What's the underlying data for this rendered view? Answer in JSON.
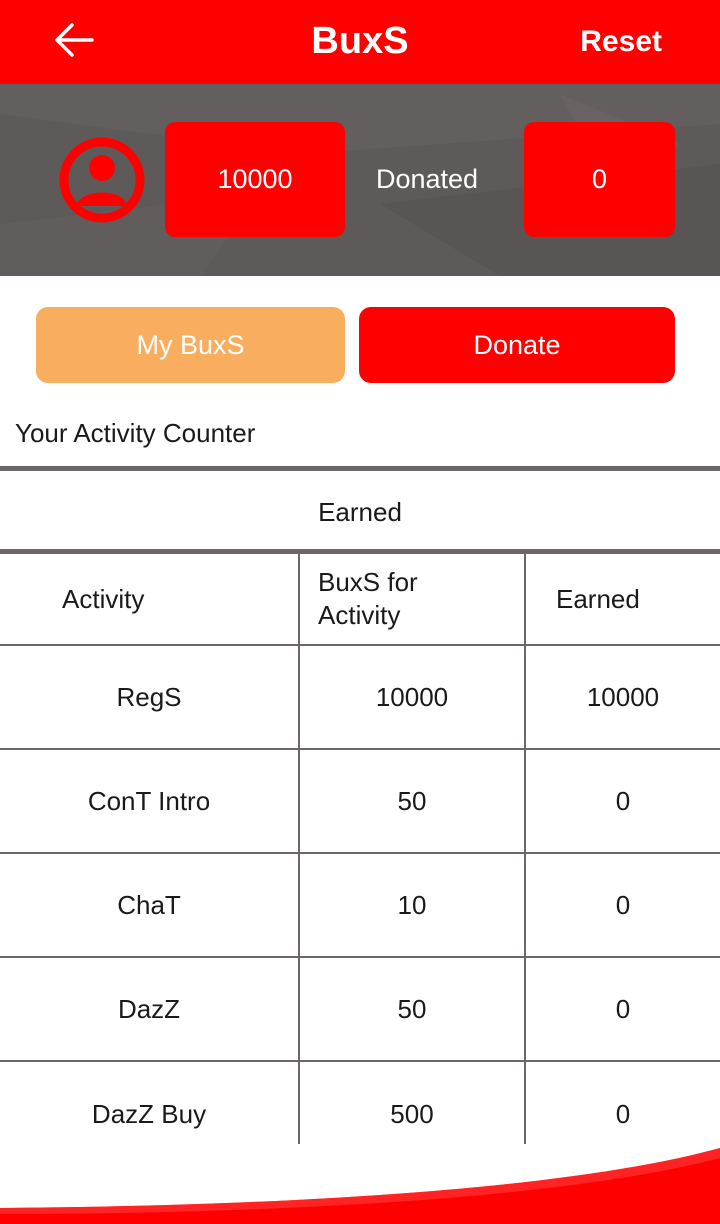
{
  "appbar": {
    "title": "BuxS",
    "reset_label": "Reset",
    "back_icon": "arrow-left-icon"
  },
  "profile": {
    "avatar_icon": "user-avatar-icon",
    "balance": "10000",
    "donated_label": "Donated",
    "donated_value": "0"
  },
  "actions": {
    "my_buxs_label": "My BuxS",
    "donate_label": "Donate"
  },
  "activity": {
    "section_title": "Your Activity Counter",
    "tab_label": "Earned",
    "columns": [
      "Activity",
      "BuxS for Activity",
      "Earned"
    ],
    "rows": [
      {
        "activity": "RegS",
        "buxs": "10000",
        "earned": "10000"
      },
      {
        "activity": "ConT Intro",
        "buxs": "50",
        "earned": "0"
      },
      {
        "activity": "ChaT",
        "buxs": "10",
        "earned": "0"
      },
      {
        "activity": "DazZ",
        "buxs": "50",
        "earned": "0"
      },
      {
        "activity": "DazZ Buy",
        "buxs": "500",
        "earned": "0"
      }
    ]
  },
  "colors": {
    "primary": "#ff0000",
    "accent_orange": "#f9ad5e",
    "banner_bg": "#5f5a5a",
    "divider": "#6e6767"
  }
}
